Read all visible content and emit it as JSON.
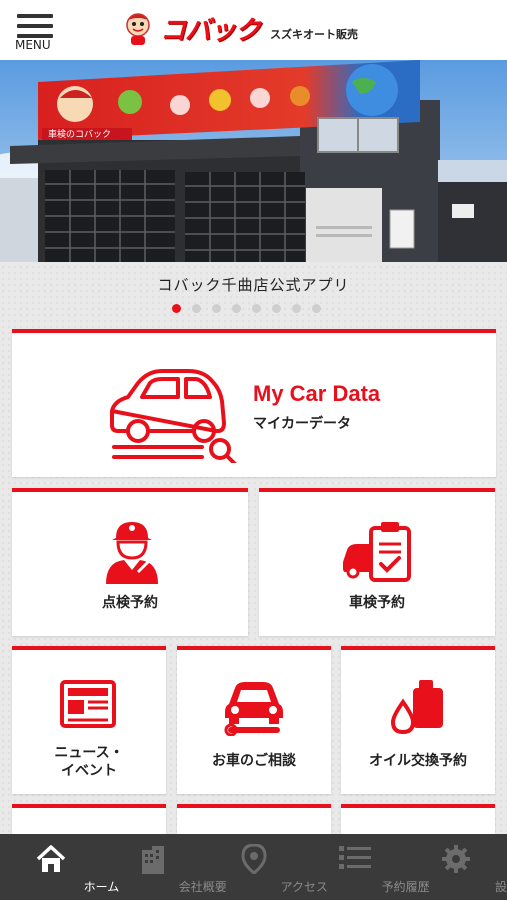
{
  "header": {
    "menu_label": "MENU",
    "logo_text": "コバック",
    "store_name": "スズキオート販売"
  },
  "hero": {
    "banner_text": "車検のコバック",
    "caption": "コバック千曲店公式アプリ",
    "slide_count": 8,
    "active_slide": 1
  },
  "cards": {
    "my_car": {
      "title": "My Car Data",
      "subtitle": "マイカーデータ"
    },
    "inspection": {
      "label": "点検予約"
    },
    "shaken": {
      "label": "車検予約"
    },
    "news": {
      "label_line1": "ニュース・",
      "label_line2": "イベント"
    },
    "consult": {
      "label": "お車のご相談"
    },
    "oil": {
      "label": "オイル交換予約"
    }
  },
  "bottom_nav": {
    "items": [
      {
        "label": "ホーム",
        "icon": "home-icon",
        "active": true
      },
      {
        "label": "会社概要",
        "icon": "building-icon",
        "active": false
      },
      {
        "label": "アクセス",
        "icon": "map-pin-icon",
        "active": false
      },
      {
        "label": "予約履歴",
        "icon": "list-icon",
        "active": false
      },
      {
        "label": "設定",
        "icon": "gear-icon",
        "active": false
      }
    ]
  },
  "colors": {
    "brand_red": "#e8111b",
    "nav_bg": "#3a3a3a",
    "text": "#222222"
  }
}
